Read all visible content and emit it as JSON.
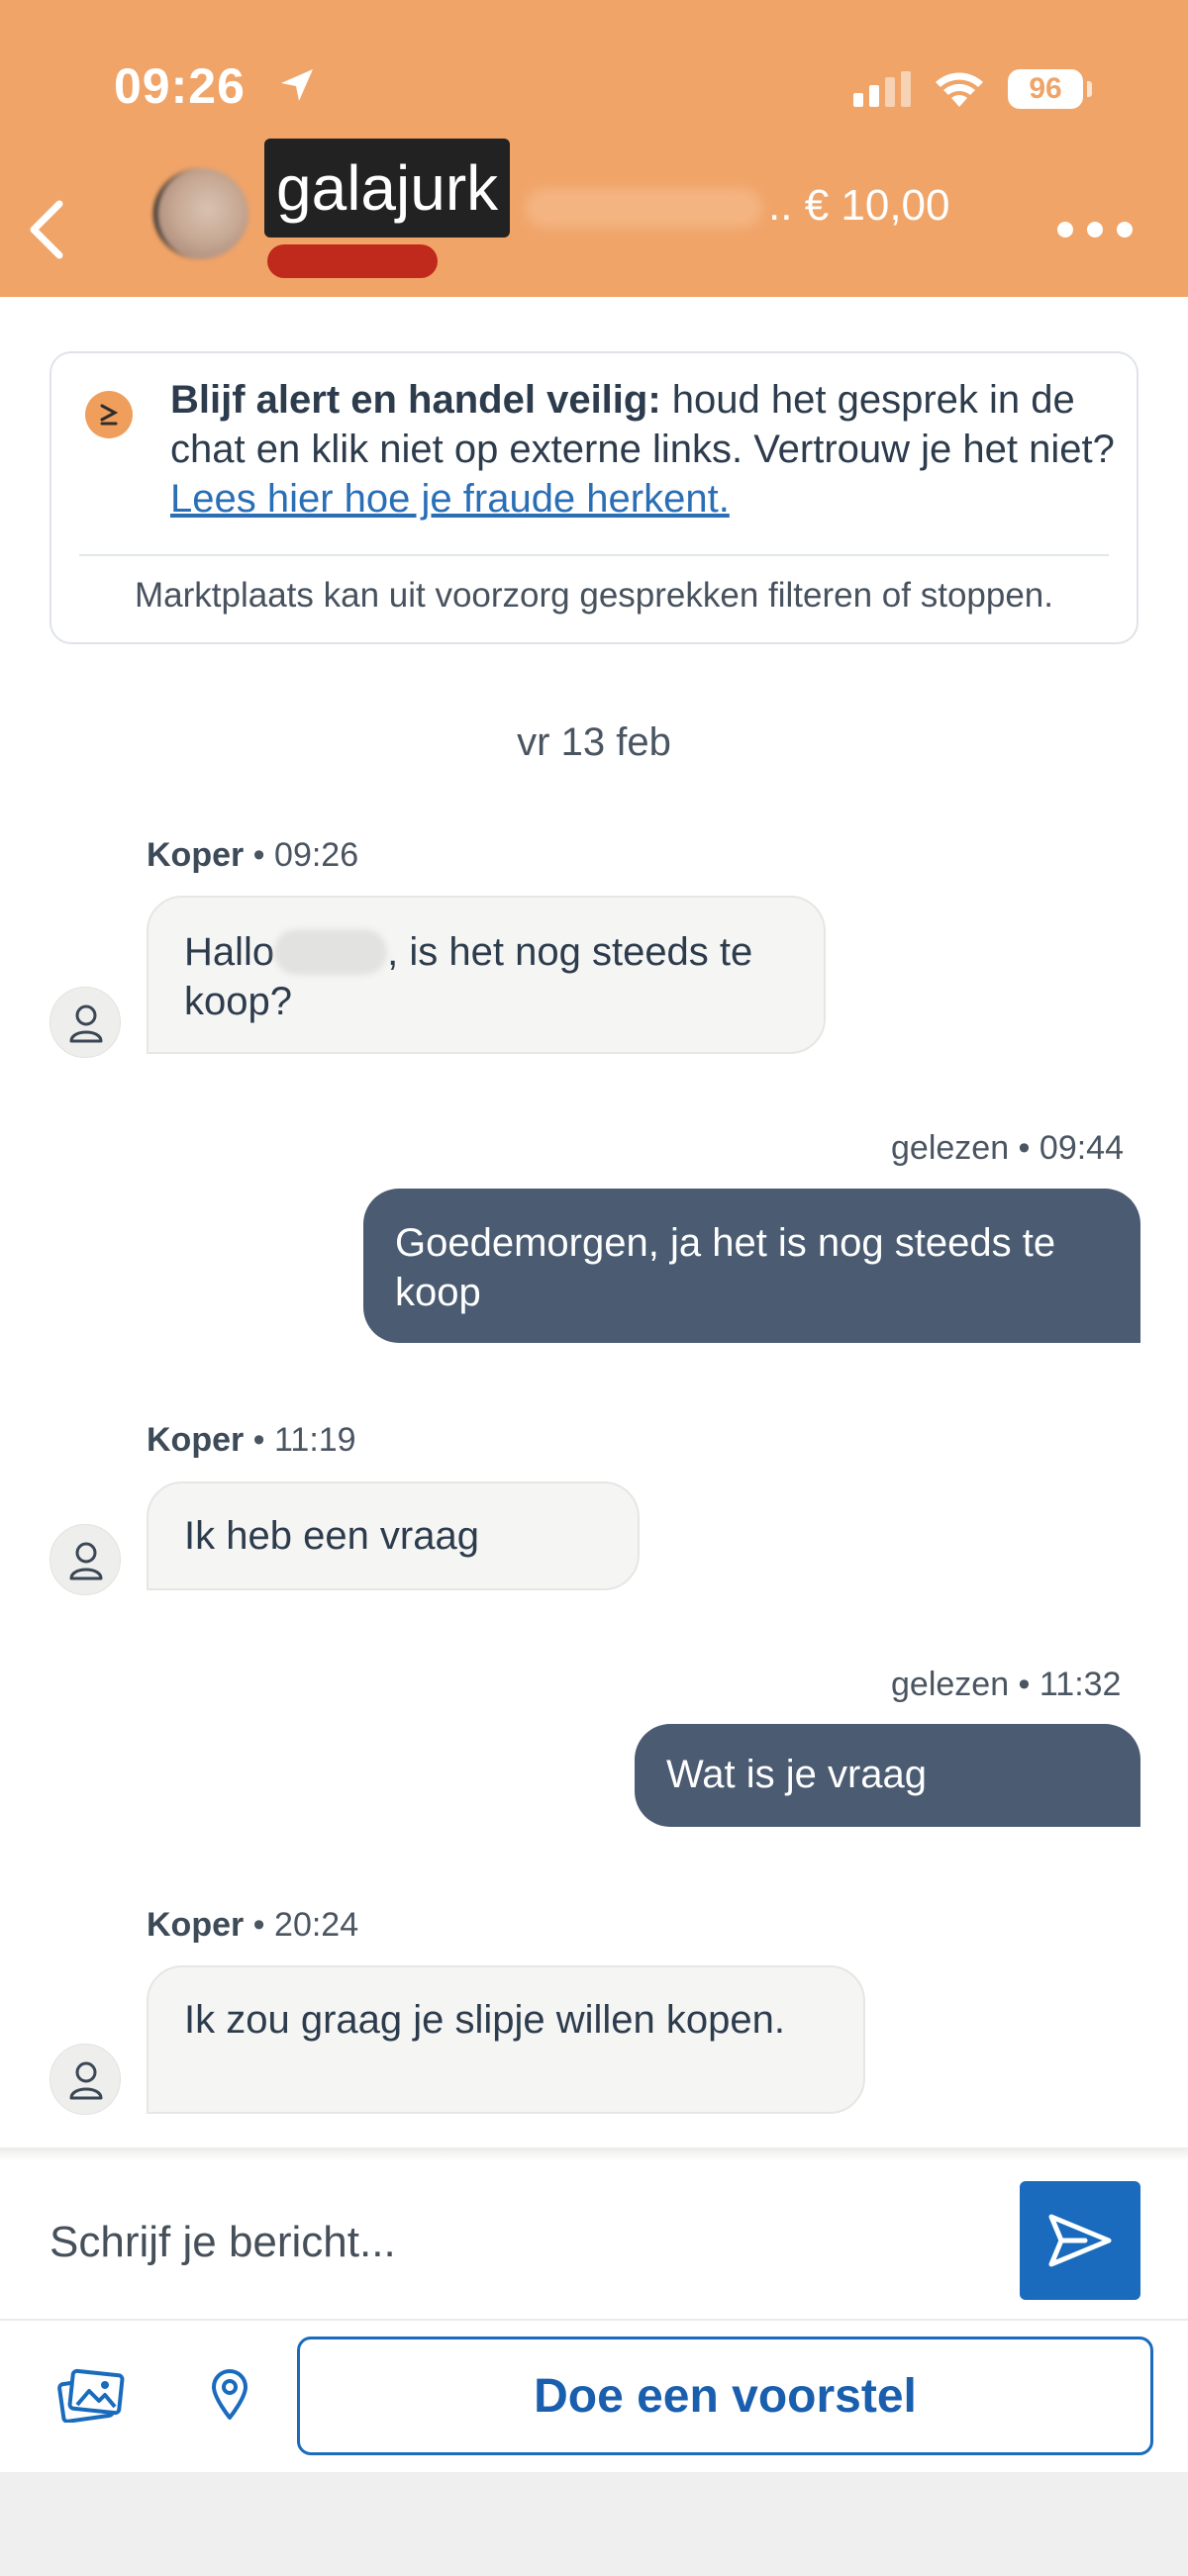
{
  "status_bar": {
    "time": "09:26",
    "battery": "96"
  },
  "header": {
    "title": "galajurk",
    "price": "€ 10,00",
    "price_prefix": ".."
  },
  "safety": {
    "bold": "Blijf alert en handel veilig:",
    "text": " houd het gesprek in de chat en klik niet op externe links. Vertrouw je het niet? ",
    "link": "Lees hier hoe je fraude herkent.",
    "footer": "Marktplaats kan uit voorzorg gesprekken filteren of stoppen."
  },
  "date_separator": "vr 13 feb",
  "messages": [
    {
      "sender": "Koper",
      "time": "09:26",
      "text_before": "Hallo",
      "text_after": ", is het nog steeds te koop?"
    },
    {
      "status": "gelezen",
      "time": "09:44",
      "text": "Goedemorgen, ja het is nog steeds te koop"
    },
    {
      "sender": "Koper",
      "time": "11:19",
      "text": "Ik heb een vraag"
    },
    {
      "status": "gelezen",
      "time": "11:32",
      "text": "Wat is je vraag"
    },
    {
      "sender": "Koper",
      "time": "20:24",
      "text": "Ik zou graag je slipje willen kopen."
    }
  ],
  "composer": {
    "placeholder": "Schrijf je bericht...",
    "offer_label": "Doe een voorstel"
  },
  "colors": {
    "header": "#f0a468",
    "accent": "#1a6bbd",
    "outgoing_bubble": "#4a5b72"
  }
}
